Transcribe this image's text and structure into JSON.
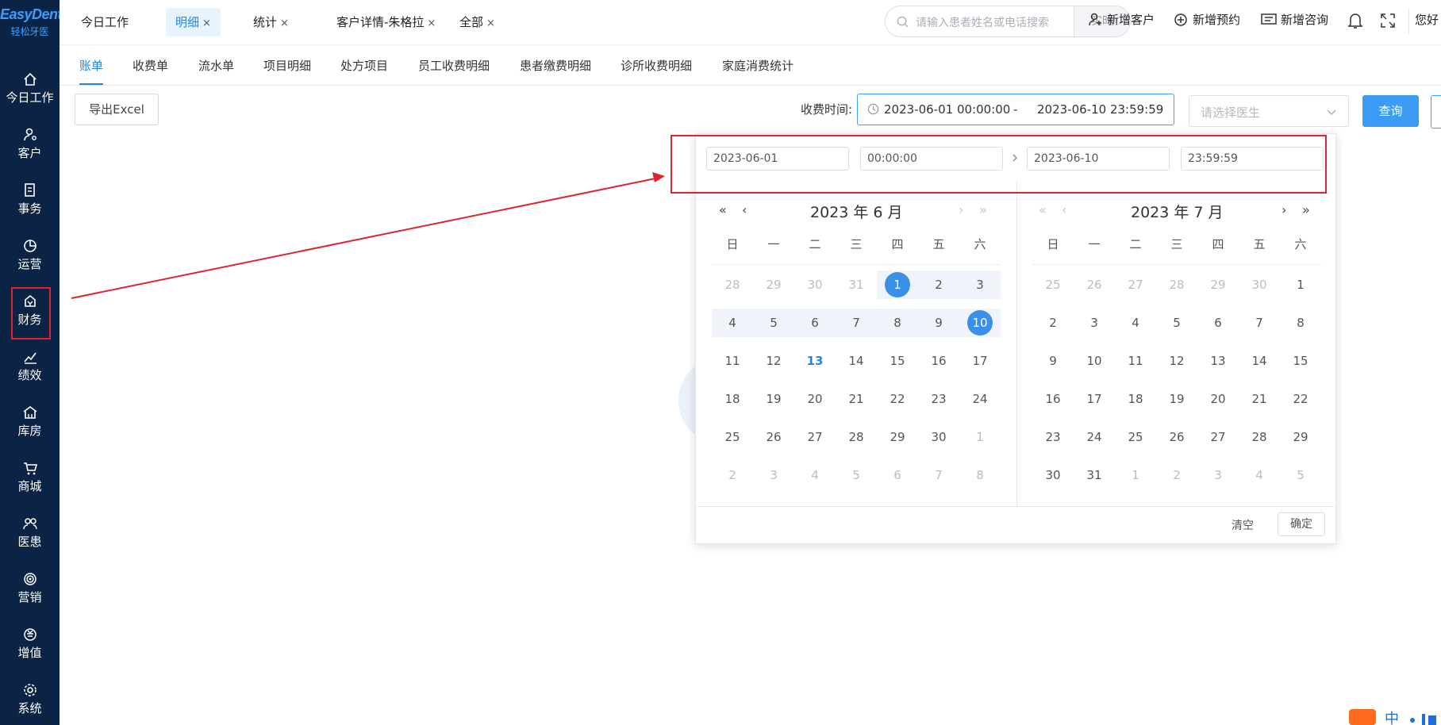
{
  "brand": {
    "logo_en": "EasyDent",
    "logo_cn": "轻松牙医"
  },
  "sidebar": {
    "items": [
      {
        "label": "今日工作",
        "icon": "home-icon"
      },
      {
        "label": "客户",
        "icon": "user-icon"
      },
      {
        "label": "事务",
        "icon": "task-icon"
      },
      {
        "label": "运营",
        "icon": "pie-chart-icon"
      },
      {
        "label": "财务",
        "icon": "finance-icon",
        "active": true
      },
      {
        "label": "绩效",
        "icon": "trend-icon"
      },
      {
        "label": "库房",
        "icon": "warehouse-icon"
      },
      {
        "label": "商城",
        "icon": "cart-icon"
      },
      {
        "label": "医患",
        "icon": "doctor-patient-icon"
      },
      {
        "label": "营销",
        "icon": "target-icon"
      },
      {
        "label": "增值",
        "icon": "value-icon"
      },
      {
        "label": "系统",
        "icon": "gear-icon"
      }
    ]
  },
  "top_tabs": [
    {
      "label": "今日工作",
      "closable": false
    },
    {
      "label": "明细",
      "closable": true,
      "active": true
    },
    {
      "label": "统计",
      "closable": true
    },
    {
      "label": "客户详情-朱格拉",
      "closable": true
    },
    {
      "label": "全部",
      "closable": true
    }
  ],
  "close_glyph": "×",
  "search": {
    "placeholder": "请输入患者姓名或电话搜索",
    "mode": "实时"
  },
  "top_actions": {
    "new_customer": "新增客户",
    "new_appointment": "新增预约",
    "new_consult": "新增咨询",
    "greeting": "您好"
  },
  "sub_tabs": [
    "账单",
    "收费单",
    "流水单",
    "项目明细",
    "处方项目",
    "员工收费明细",
    "患者缴费明细",
    "诊所收费明细",
    "家庭消费统计"
  ],
  "toolbar": {
    "export_label": "导出Excel",
    "fee_time_label": "收费时间:",
    "range_start": "2023-06-01 00:00:00",
    "range_sep": "-",
    "range_end": "2023-06-10 23:59:59",
    "doctor_placeholder": "请选择医生",
    "query_label": "查询"
  },
  "picker": {
    "start_date": "2023-06-01",
    "start_time": "00:00:00",
    "end_date": "2023-06-10",
    "end_time": "23:59:59",
    "left_title": "2023 年 6 月",
    "right_title": "2023 年 7 月",
    "weekdays": [
      "日",
      "一",
      "二",
      "三",
      "四",
      "五",
      "六"
    ],
    "left_days": [
      [
        "28",
        "29",
        "30",
        "31",
        "1",
        "2",
        "3"
      ],
      [
        "4",
        "5",
        "6",
        "7",
        "8",
        "9",
        "10"
      ],
      [
        "11",
        "12",
        "13",
        "14",
        "15",
        "16",
        "17"
      ],
      [
        "18",
        "19",
        "20",
        "21",
        "22",
        "23",
        "24"
      ],
      [
        "25",
        "26",
        "27",
        "28",
        "29",
        "30",
        "1"
      ],
      [
        "2",
        "3",
        "4",
        "5",
        "6",
        "7",
        "8"
      ]
    ],
    "right_days": [
      [
        "25",
        "26",
        "27",
        "28",
        "29",
        "30",
        "1"
      ],
      [
        "2",
        "3",
        "4",
        "5",
        "6",
        "7",
        "8"
      ],
      [
        "9",
        "10",
        "11",
        "12",
        "13",
        "14",
        "15"
      ],
      [
        "16",
        "17",
        "18",
        "19",
        "20",
        "21",
        "22"
      ],
      [
        "23",
        "24",
        "25",
        "26",
        "27",
        "28",
        "29"
      ],
      [
        "30",
        "31",
        "1",
        "2",
        "3",
        "4",
        "5"
      ]
    ],
    "selected_start_day": "1",
    "selected_end_day": "10",
    "today_day": "13",
    "clear_label": "清空",
    "confirm_label": "确定"
  },
  "colors": {
    "accent": "#1e88e5",
    "sidebar_bg": "#0b2445",
    "annotation_red": "#e0242d"
  }
}
